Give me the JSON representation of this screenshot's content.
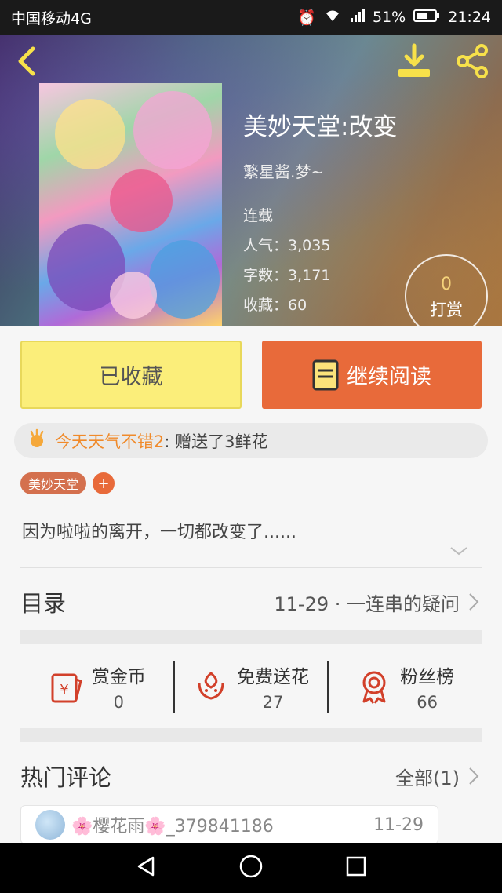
{
  "status_bar": {
    "carrier": "中国移动4G",
    "battery": "51%",
    "time": "21:24"
  },
  "book": {
    "title": "美妙天堂:改变",
    "author": "繁星酱.梦~",
    "status": "连载",
    "popularity_label": "人气：",
    "popularity": "3,035",
    "words_label": "字数：",
    "words": "3,171",
    "favorites_label": "收藏：",
    "favorites": "60",
    "reward_count": "0",
    "reward_label": "打赏",
    "description": "因为啦啦的离开，一切都改变了......"
  },
  "buttons": {
    "favorited": "已收藏",
    "continue_reading": "继续阅读"
  },
  "gift": {
    "giver": "今天天气不错2",
    "message": ": 赠送了3鲜花"
  },
  "tags": [
    "美妙天堂"
  ],
  "tag_add": "+",
  "catalog": {
    "label": "目录",
    "latest": "11-29 · 一连串的疑问"
  },
  "stats": [
    {
      "label": "赏金币",
      "value": "0",
      "icon": "red-envelope-icon"
    },
    {
      "label": "免费送花",
      "value": "27",
      "icon": "flower-icon"
    },
    {
      "label": "粉丝榜",
      "value": "66",
      "icon": "medal-icon"
    }
  ],
  "hot_comments": {
    "label": "热门评论",
    "all": "全部(1)"
  },
  "comment": {
    "user": "🌸樱花雨🌸_379841186",
    "date": "11-29"
  },
  "colors": {
    "accent": "#e86a3a",
    "favorite_bg": "#fbee7a",
    "gift_name": "#f08a2a",
    "reward_number": "#f4d27a"
  }
}
